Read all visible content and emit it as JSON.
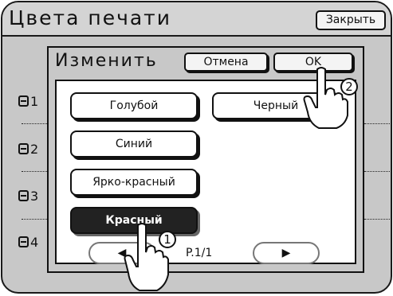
{
  "window": {
    "title": "Цвета печати",
    "close_label": "Закрыть"
  },
  "drums": [
    {
      "label": "1",
      "icon": "drum-icon"
    },
    {
      "label": "2",
      "icon": "drum-icon"
    },
    {
      "label": "3",
      "icon": "drum-icon"
    },
    {
      "label": "4",
      "icon": "drum-icon"
    }
  ],
  "dialog": {
    "title": "Изменить",
    "cancel_label": "Отмена",
    "ok_label": "OK",
    "colors": [
      {
        "label": "Голубой",
        "selected": false
      },
      {
        "label": "Черный",
        "selected": false
      },
      {
        "label": "Синий",
        "selected": false
      },
      {
        "label": "Ярко-красный",
        "selected": false
      },
      {
        "label": "Красный",
        "selected": true
      }
    ],
    "pager": {
      "prev_symbol": "◀",
      "next_symbol": "▶",
      "page": "P.1/1"
    }
  },
  "callouts": [
    {
      "number": "1",
      "icon": "pointing-hand-icon"
    },
    {
      "number": "2",
      "icon": "pointing-hand-icon"
    }
  ],
  "colors": {
    "panel_bg": "#c8c8c8",
    "selected_bg": "#222222",
    "border": "#111111"
  }
}
